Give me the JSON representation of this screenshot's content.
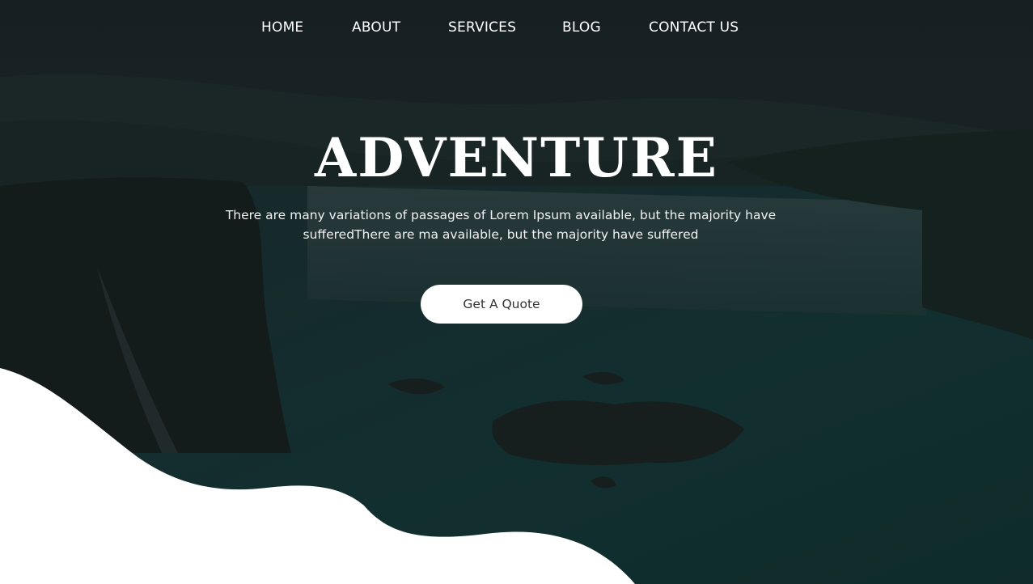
{
  "nav": {
    "items": [
      {
        "label": "HOME"
      },
      {
        "label": "ABOUT"
      },
      {
        "label": "SERVICES"
      },
      {
        "label": "BLOG"
      },
      {
        "label": "CONTACT US"
      }
    ]
  },
  "hero": {
    "title": "ADVENTURE",
    "description": "There are many variations of passages of Lorem Ipsum available, but the majority have sufferedThere are ma available, but the majority have suffered",
    "cta_label": "Get A Quote",
    "background_image": "waterfall-landscape-image"
  },
  "colors": {
    "overlay": "#0f1a1c",
    "text": "#ffffff",
    "button_bg": "#ffffff",
    "button_text": "#333333",
    "wave": "#ffffff"
  }
}
